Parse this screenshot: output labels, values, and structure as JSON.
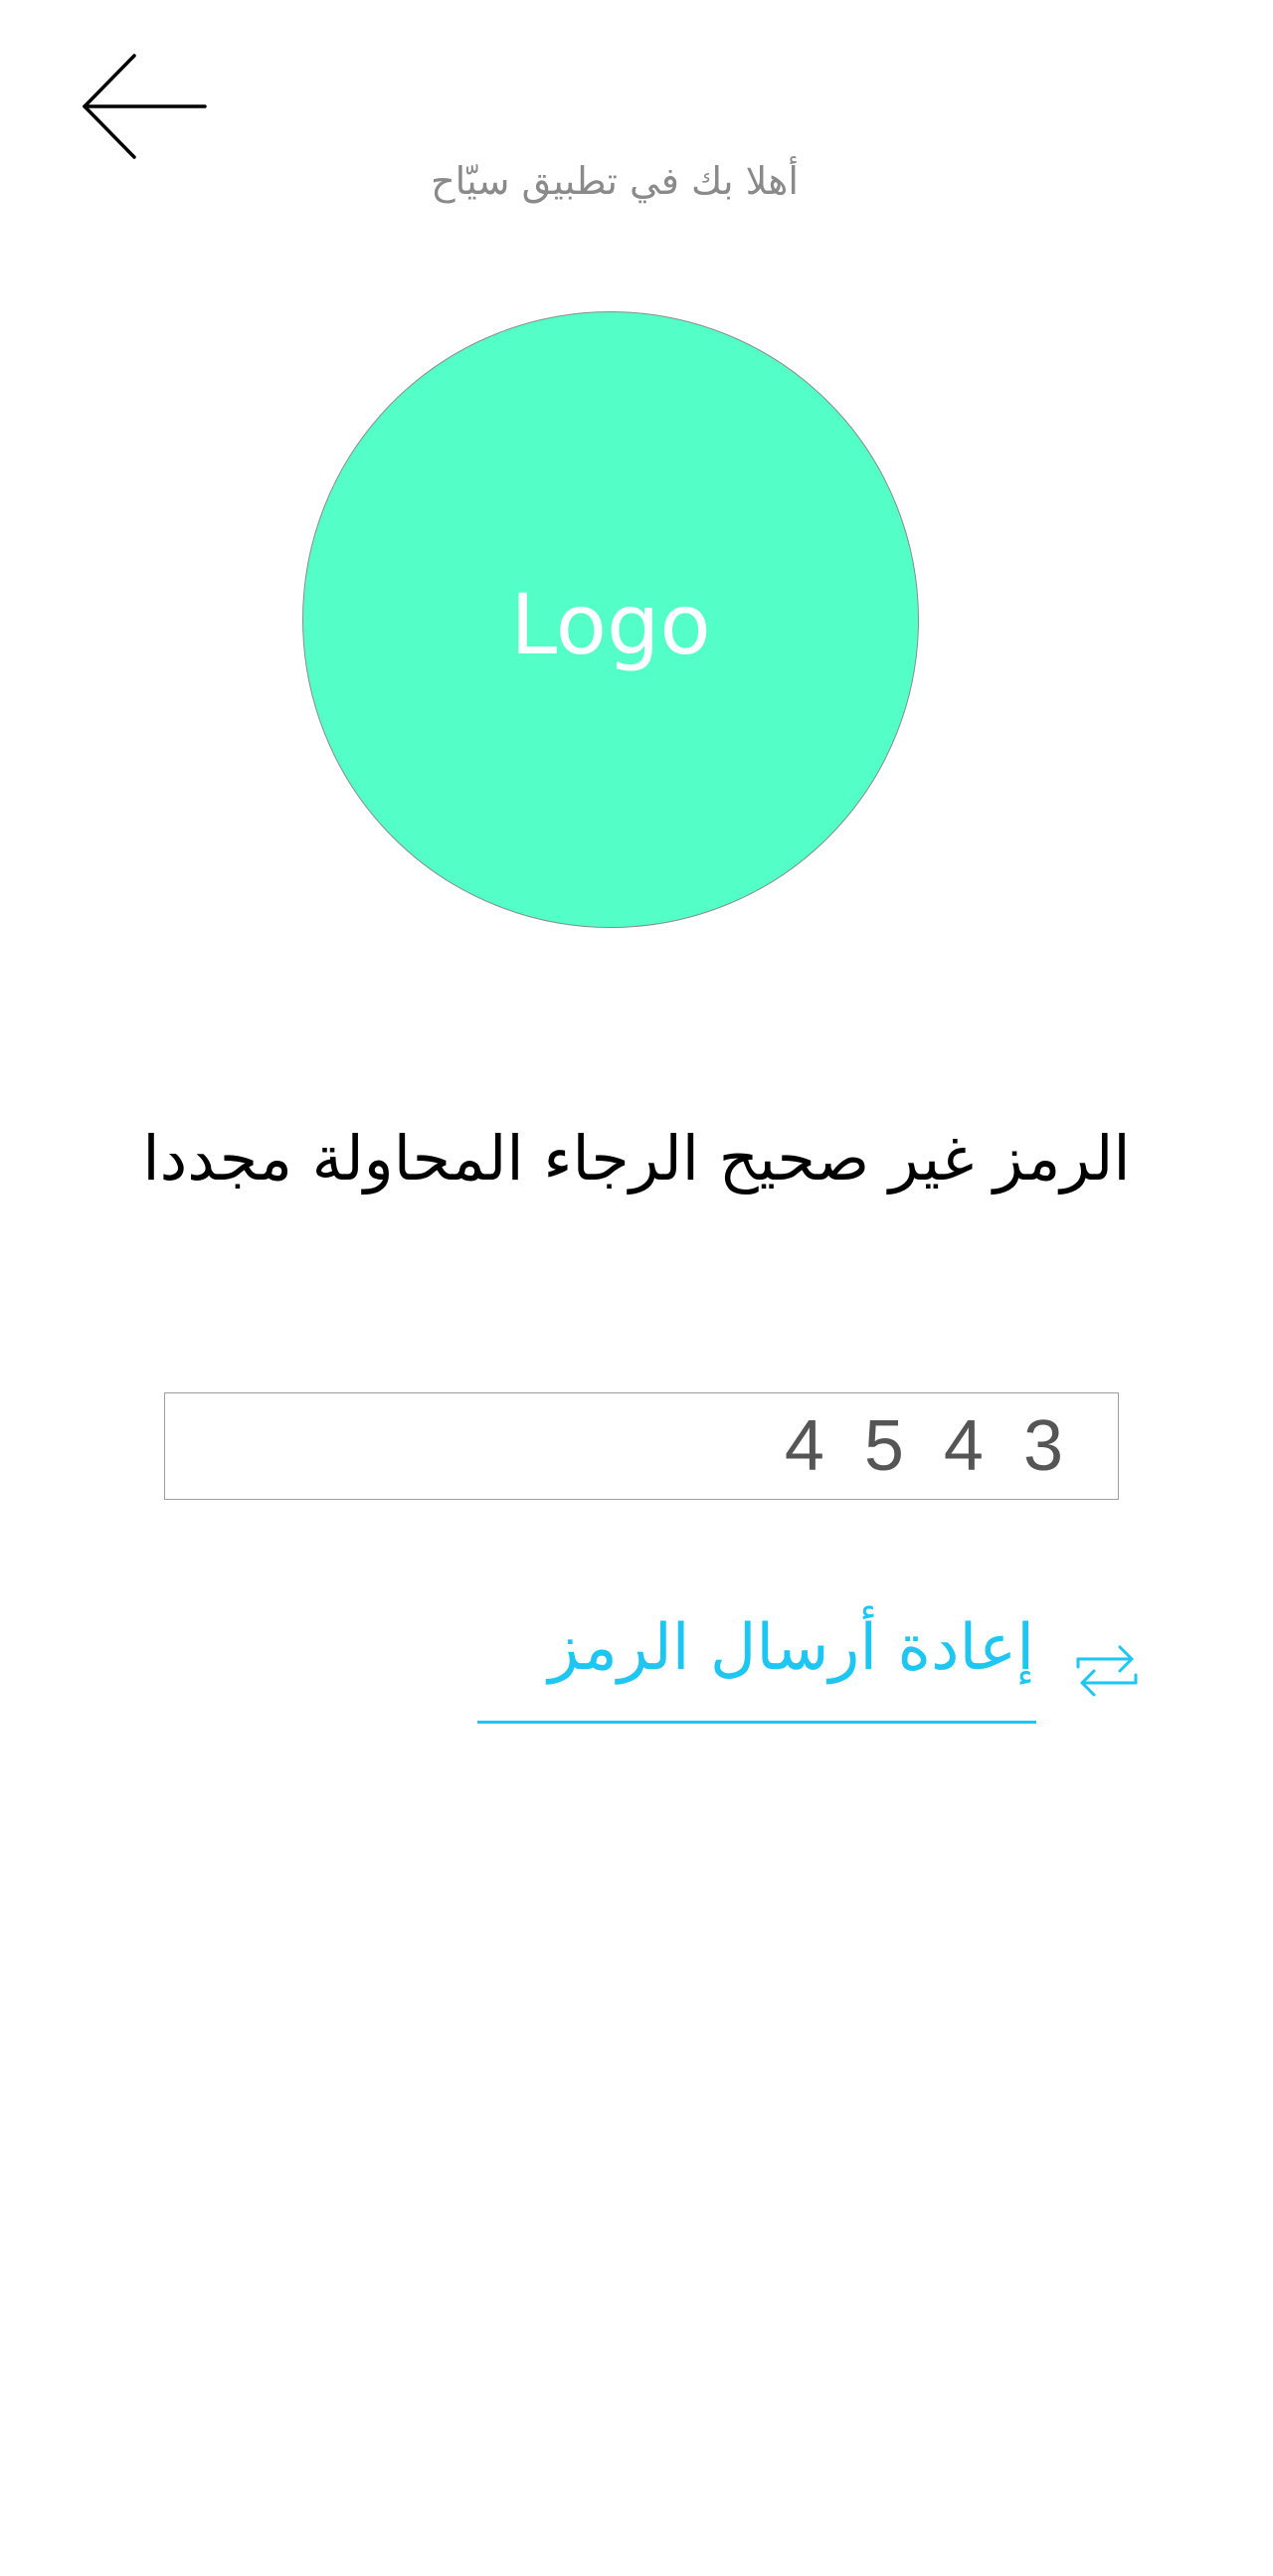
{
  "header": {
    "back_icon": "arrow-left-icon",
    "welcome_text": "أهلا بك في تطبيق سيّاح"
  },
  "logo": {
    "label": "Logo",
    "fill_color": "#53ffc6"
  },
  "verification": {
    "error_message": "الرمز غير صحيح الرجاء المحاولة مجددا",
    "code_value": "4 5 4 3"
  },
  "resend": {
    "label": "إعادة أرسال الرمز",
    "icon": "refresh-icon",
    "color": "#1ec6f2"
  }
}
